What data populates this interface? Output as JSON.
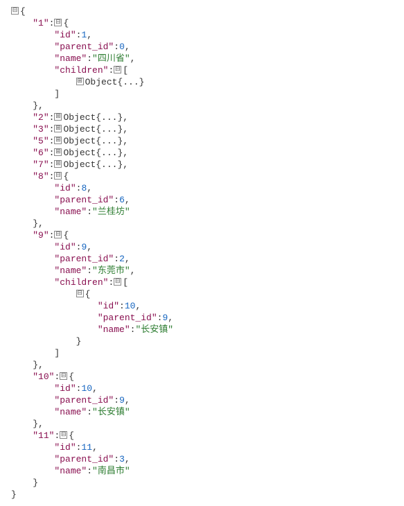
{
  "icons": {
    "collapse": "⊟",
    "expand": "⊞"
  },
  "punct": {
    "open_brace": "{",
    "close_brace": "}",
    "open_bracket": "[",
    "close_bracket": "]",
    "colon": ":",
    "comma": ","
  },
  "collapsed_object": "Object{...}",
  "root": {
    "key1": {
      "key": "\"1\"",
      "id_key": "\"id\"",
      "id_val": "1",
      "parent_key": "\"parent_id\"",
      "parent_val": "0",
      "name_key": "\"name\"",
      "name_val": "\"四川省\"",
      "children_key": "\"children\""
    },
    "key2": {
      "key": "\"2\""
    },
    "key3": {
      "key": "\"3\""
    },
    "key5": {
      "key": "\"5\""
    },
    "key6": {
      "key": "\"6\""
    },
    "key7": {
      "key": "\"7\""
    },
    "key8": {
      "key": "\"8\"",
      "id_key": "\"id\"",
      "id_val": "8",
      "parent_key": "\"parent_id\"",
      "parent_val": "6",
      "name_key": "\"name\"",
      "name_val": "\"兰桂坊\""
    },
    "key9": {
      "key": "\"9\"",
      "id_key": "\"id\"",
      "id_val": "9",
      "parent_key": "\"parent_id\"",
      "parent_val": "2",
      "name_key": "\"name\"",
      "name_val": "\"东莞市\"",
      "children_key": "\"children\"",
      "child": {
        "id_key": "\"id\"",
        "id_val": "10",
        "parent_key": "\"parent_id\"",
        "parent_val": "9",
        "name_key": "\"name\"",
        "name_val": "\"长安镇\""
      }
    },
    "key10": {
      "key": "\"10\"",
      "id_key": "\"id\"",
      "id_val": "10",
      "parent_key": "\"parent_id\"",
      "parent_val": "9",
      "name_key": "\"name\"",
      "name_val": "\"长安镇\""
    },
    "key11": {
      "key": "\"11\"",
      "id_key": "\"id\"",
      "id_val": "11",
      "parent_key": "\"parent_id\"",
      "parent_val": "3",
      "name_key": "\"name\"",
      "name_val": "\"南昌市\""
    }
  }
}
